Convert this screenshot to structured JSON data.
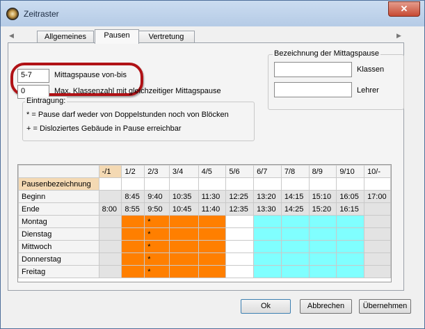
{
  "window": {
    "title": "Zeitraster",
    "close": "✕"
  },
  "tabs": [
    {
      "label": "Allgemeines"
    },
    {
      "label": "Pausen"
    },
    {
      "label": "Vertretung"
    }
  ],
  "form": {
    "lunch_value": "5-7",
    "lunch_label": "Mittagspause von-bis",
    "max_value": "0",
    "max_label": "Max. Klassenzahl mit gleichzeitiger Mittagspause",
    "lunch_name_title": "Bezeichnung der Mittagspause",
    "klassen_value": "",
    "klassen_label": "Klassen",
    "lehrer_value": "",
    "lehrer_label": "Lehrer"
  },
  "legend": {
    "title": "Eintragung:",
    "line1": "* = Pause darf weder von Doppelstunden noch von Blöcken",
    "line2": "+ = Disloziertes Gebäude in Pause erreichbar"
  },
  "grid": {
    "columns": [
      "-/1",
      "1/2",
      "2/3",
      "3/4",
      "4/5",
      "5/6",
      "6/7",
      "7/8",
      "8/9",
      "9/10",
      "10/-"
    ],
    "rows": [
      {
        "label": "Pausenbezeichnung",
        "cells": [
          "",
          "",
          "",
          "",
          "",
          "",
          "",
          "",
          "",
          "",
          ""
        ]
      },
      {
        "label": "Beginn",
        "cells": [
          "",
          "8:45",
          "9:40",
          "10:35",
          "11:30",
          "12:25",
          "13:20",
          "14:15",
          "15:10",
          "16:05",
          "17:00"
        ]
      },
      {
        "label": "Ende",
        "cells": [
          "8:00",
          "8:55",
          "9:50",
          "10:45",
          "11:40",
          "12:35",
          "13:30",
          "14:25",
          "15:20",
          "16:15",
          ""
        ]
      },
      {
        "label": "Montag",
        "cells": [
          "",
          "",
          "*",
          "",
          "",
          "",
          "",
          "",
          "",
          "",
          ""
        ]
      },
      {
        "label": "Dienstag",
        "cells": [
          "",
          "",
          "*",
          "",
          "",
          "",
          "",
          "",
          "",
          "",
          ""
        ]
      },
      {
        "label": "Mittwoch",
        "cells": [
          "",
          "",
          "*",
          "",
          "",
          "",
          "",
          "",
          "",
          "",
          ""
        ]
      },
      {
        "label": "Donnerstag",
        "cells": [
          "",
          "",
          "*",
          "",
          "",
          "",
          "",
          "",
          "",
          "",
          ""
        ]
      },
      {
        "label": "Freitag",
        "cells": [
          "",
          "",
          "*",
          "",
          "",
          "",
          "",
          "",
          "",
          "",
          ""
        ]
      }
    ],
    "day_colors": [
      "gray",
      "orange",
      "orange",
      "orange",
      "orange",
      "white",
      "cyan",
      "cyan",
      "cyan",
      "cyan",
      "gray"
    ]
  },
  "colors": {
    "break": "#ff7f00",
    "lunch": "#ffffff",
    "afternoon": "#80ffff",
    "highlight": "#b01216"
  },
  "buttons": {
    "ok": "Ok",
    "cancel": "Abbrechen",
    "apply": "Übernehmen"
  }
}
